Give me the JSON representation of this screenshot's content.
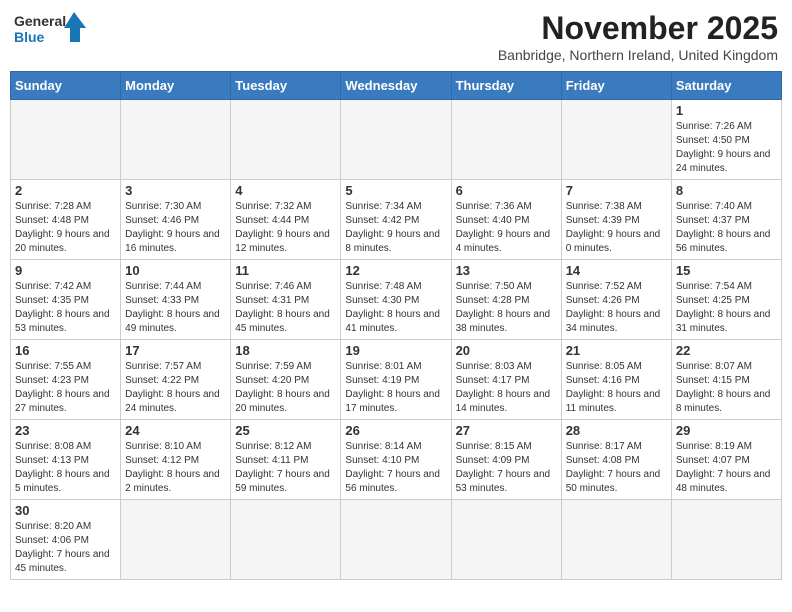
{
  "logo": {
    "line1": "General",
    "line2": "Blue"
  },
  "title": "November 2025",
  "subtitle": "Banbridge, Northern Ireland, United Kingdom",
  "days_of_week": [
    "Sunday",
    "Monday",
    "Tuesday",
    "Wednesday",
    "Thursday",
    "Friday",
    "Saturday"
  ],
  "weeks": [
    [
      {
        "day": "",
        "info": ""
      },
      {
        "day": "",
        "info": ""
      },
      {
        "day": "",
        "info": ""
      },
      {
        "day": "",
        "info": ""
      },
      {
        "day": "",
        "info": ""
      },
      {
        "day": "",
        "info": ""
      },
      {
        "day": "1",
        "info": "Sunrise: 7:26 AM\nSunset: 4:50 PM\nDaylight: 9 hours and 24 minutes."
      }
    ],
    [
      {
        "day": "2",
        "info": "Sunrise: 7:28 AM\nSunset: 4:48 PM\nDaylight: 9 hours and 20 minutes."
      },
      {
        "day": "3",
        "info": "Sunrise: 7:30 AM\nSunset: 4:46 PM\nDaylight: 9 hours and 16 minutes."
      },
      {
        "day": "4",
        "info": "Sunrise: 7:32 AM\nSunset: 4:44 PM\nDaylight: 9 hours and 12 minutes."
      },
      {
        "day": "5",
        "info": "Sunrise: 7:34 AM\nSunset: 4:42 PM\nDaylight: 9 hours and 8 minutes."
      },
      {
        "day": "6",
        "info": "Sunrise: 7:36 AM\nSunset: 4:40 PM\nDaylight: 9 hours and 4 minutes."
      },
      {
        "day": "7",
        "info": "Sunrise: 7:38 AM\nSunset: 4:39 PM\nDaylight: 9 hours and 0 minutes."
      },
      {
        "day": "8",
        "info": "Sunrise: 7:40 AM\nSunset: 4:37 PM\nDaylight: 8 hours and 56 minutes."
      }
    ],
    [
      {
        "day": "9",
        "info": "Sunrise: 7:42 AM\nSunset: 4:35 PM\nDaylight: 8 hours and 53 minutes."
      },
      {
        "day": "10",
        "info": "Sunrise: 7:44 AM\nSunset: 4:33 PM\nDaylight: 8 hours and 49 minutes."
      },
      {
        "day": "11",
        "info": "Sunrise: 7:46 AM\nSunset: 4:31 PM\nDaylight: 8 hours and 45 minutes."
      },
      {
        "day": "12",
        "info": "Sunrise: 7:48 AM\nSunset: 4:30 PM\nDaylight: 8 hours and 41 minutes."
      },
      {
        "day": "13",
        "info": "Sunrise: 7:50 AM\nSunset: 4:28 PM\nDaylight: 8 hours and 38 minutes."
      },
      {
        "day": "14",
        "info": "Sunrise: 7:52 AM\nSunset: 4:26 PM\nDaylight: 8 hours and 34 minutes."
      },
      {
        "day": "15",
        "info": "Sunrise: 7:54 AM\nSunset: 4:25 PM\nDaylight: 8 hours and 31 minutes."
      }
    ],
    [
      {
        "day": "16",
        "info": "Sunrise: 7:55 AM\nSunset: 4:23 PM\nDaylight: 8 hours and 27 minutes."
      },
      {
        "day": "17",
        "info": "Sunrise: 7:57 AM\nSunset: 4:22 PM\nDaylight: 8 hours and 24 minutes."
      },
      {
        "day": "18",
        "info": "Sunrise: 7:59 AM\nSunset: 4:20 PM\nDaylight: 8 hours and 20 minutes."
      },
      {
        "day": "19",
        "info": "Sunrise: 8:01 AM\nSunset: 4:19 PM\nDaylight: 8 hours and 17 minutes."
      },
      {
        "day": "20",
        "info": "Sunrise: 8:03 AM\nSunset: 4:17 PM\nDaylight: 8 hours and 14 minutes."
      },
      {
        "day": "21",
        "info": "Sunrise: 8:05 AM\nSunset: 4:16 PM\nDaylight: 8 hours and 11 minutes."
      },
      {
        "day": "22",
        "info": "Sunrise: 8:07 AM\nSunset: 4:15 PM\nDaylight: 8 hours and 8 minutes."
      }
    ],
    [
      {
        "day": "23",
        "info": "Sunrise: 8:08 AM\nSunset: 4:13 PM\nDaylight: 8 hours and 5 minutes."
      },
      {
        "day": "24",
        "info": "Sunrise: 8:10 AM\nSunset: 4:12 PM\nDaylight: 8 hours and 2 minutes."
      },
      {
        "day": "25",
        "info": "Sunrise: 8:12 AM\nSunset: 4:11 PM\nDaylight: 7 hours and 59 minutes."
      },
      {
        "day": "26",
        "info": "Sunrise: 8:14 AM\nSunset: 4:10 PM\nDaylight: 7 hours and 56 minutes."
      },
      {
        "day": "27",
        "info": "Sunrise: 8:15 AM\nSunset: 4:09 PM\nDaylight: 7 hours and 53 minutes."
      },
      {
        "day": "28",
        "info": "Sunrise: 8:17 AM\nSunset: 4:08 PM\nDaylight: 7 hours and 50 minutes."
      },
      {
        "day": "29",
        "info": "Sunrise: 8:19 AM\nSunset: 4:07 PM\nDaylight: 7 hours and 48 minutes."
      }
    ],
    [
      {
        "day": "30",
        "info": "Sunrise: 8:20 AM\nSunset: 4:06 PM\nDaylight: 7 hours and 45 minutes."
      },
      {
        "day": "",
        "info": ""
      },
      {
        "day": "",
        "info": ""
      },
      {
        "day": "",
        "info": ""
      },
      {
        "day": "",
        "info": ""
      },
      {
        "day": "",
        "info": ""
      },
      {
        "day": "",
        "info": ""
      }
    ]
  ]
}
